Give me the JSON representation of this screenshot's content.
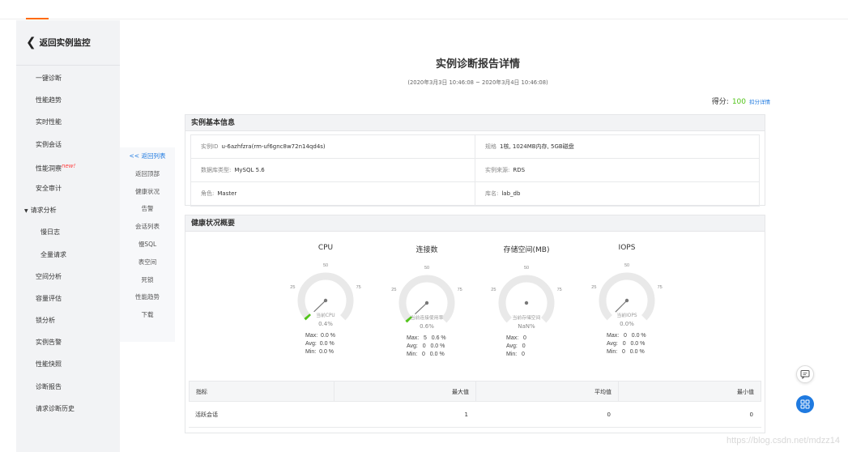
{
  "nav": {
    "back_label": "返回实例监控",
    "items": [
      {
        "label": "一键诊断"
      },
      {
        "label": "性能趋势"
      },
      {
        "label": "实时性能"
      },
      {
        "label": "实例会话"
      },
      {
        "label": "性能洞察",
        "badge": "new!"
      },
      {
        "label": "安全审计"
      },
      {
        "label": "请求分析"
      },
      {
        "label": "慢日志"
      },
      {
        "label": "全量请求"
      },
      {
        "label": "空间分析"
      },
      {
        "label": "容量评估"
      },
      {
        "label": "锁分析"
      },
      {
        "label": "实例告警"
      },
      {
        "label": "性能快照"
      },
      {
        "label": "诊断报告"
      },
      {
        "label": "请求诊断历史"
      }
    ]
  },
  "anchors": [
    {
      "label": "<< 返回列表"
    },
    {
      "label": "返回顶部"
    },
    {
      "label": "健康状况"
    },
    {
      "label": "告警"
    },
    {
      "label": "会话列表"
    },
    {
      "label": "慢SQL"
    },
    {
      "label": "表空间"
    },
    {
      "label": "死锁"
    },
    {
      "label": "性能趋势"
    },
    {
      "label": "下载"
    }
  ],
  "report": {
    "title": "实例诊断报告详情",
    "range": "(2020年3月3日 10:46:08 ~ 2020年3月4日 10:46:08)",
    "score_label": "得分:",
    "score_value": "100",
    "score_detail": "扣分详情"
  },
  "basic_info": {
    "title": "实例基本信息",
    "rows": [
      [
        {
          "k": "实例ID",
          "v": "u-6azhfzra(rm-uf6gnc8w72n14qd4s)"
        },
        {
          "k": "规格",
          "v": "1核, 1024MB内存, 5GB磁盘"
        }
      ],
      [
        {
          "k": "数据库类型:",
          "v": "MySQL 5.6"
        },
        {
          "k": "实例来源:",
          "v": "RDS"
        }
      ],
      [
        {
          "k": "角色:",
          "v": "Master"
        },
        {
          "k": "库名:",
          "v": "lab_db"
        }
      ]
    ]
  },
  "health": {
    "title": "健康状况概要",
    "gauges": [
      {
        "title": "CPU",
        "inner": "当前CPU",
        "pct": "0.4%",
        "level": 0.004,
        "ticks": [
          "0",
          "25",
          "50",
          "75",
          "100"
        ],
        "max": "Max:  0.0 %",
        "avg": "Avg:  0.0 %",
        "min": "Min:  0.0 %"
      },
      {
        "title": "连接数",
        "inner": "当前连接使用率",
        "pct": "0.6%",
        "level": 0.006,
        "ticks": [
          "0",
          "25",
          "50",
          "75",
          "100"
        ],
        "max": "Max:   5   0.6 %",
        "avg": "Avg:   0   0.0 %",
        "min": "Min:   0   0.0 %"
      },
      {
        "title": "存储空间(MB)",
        "inner": "当前存储空间",
        "pct": "NaN%",
        "level": null,
        "ticks": [
          "0",
          "25",
          "50",
          "75",
          "100"
        ],
        "max": "Max:   0",
        "avg": "Avg:   0",
        "min": "Min:   0"
      },
      {
        "title": "IOPS",
        "inner": "当前IOPS",
        "pct": "0.0%",
        "level": 0.0,
        "ticks": [
          "0",
          "25",
          "50",
          "75",
          "100"
        ],
        "max": "Max:   0   0.0 %",
        "avg": "Avg:   0   0.0 %",
        "min": "Min:   0   0.0 %"
      }
    ],
    "table": {
      "headers": [
        "指标",
        "最大值",
        "平均值",
        "最小值"
      ],
      "rows": [
        [
          "活跃会话",
          "1",
          "0",
          "0"
        ]
      ]
    }
  },
  "colors": {
    "accent": "#ff6a00",
    "link": "#1f7ae0",
    "score": "#52c41a",
    "gauge_fill": "#52c41a"
  },
  "float_buttons": {
    "message_icon": "chat-icon",
    "app_icon": "apps-icon"
  },
  "watermark": "https://blog.csdn.net/mdzz14"
}
